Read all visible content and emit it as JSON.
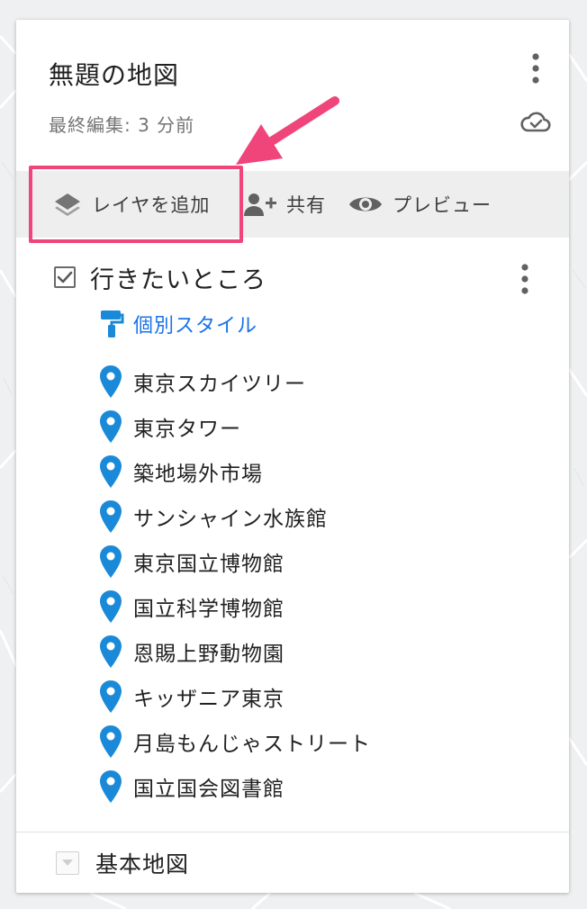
{
  "map": {
    "title": "無題の地図",
    "status": "最終編集: 3 分前"
  },
  "toolbar": {
    "add_layer": "レイヤを追加",
    "share": "共有",
    "preview": "プレビュー"
  },
  "layer": {
    "name": "行きたいところ",
    "checked": true,
    "style_label": "個別スタイル",
    "places": [
      "東京スカイツリー",
      "東京タワー",
      "築地場外市場",
      "サンシャイン水族館",
      "東京国立博物館",
      "国立科学博物館",
      "恩賜上野動物園",
      "キッザニア東京",
      "月島もんじゃストリート",
      "国立国会図書館"
    ]
  },
  "basemap": {
    "label": "基本地図"
  },
  "colors": {
    "pin": "#1a8ad8",
    "link": "#1a73e8",
    "highlight": "#f0457a"
  }
}
